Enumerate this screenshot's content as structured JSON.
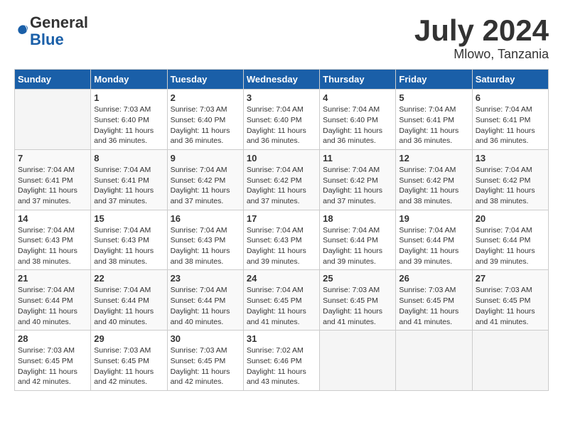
{
  "logo": {
    "general": "General",
    "blue": "Blue"
  },
  "header": {
    "month": "July 2024",
    "location": "Mlowo, Tanzania"
  },
  "weekdays": [
    "Sunday",
    "Monday",
    "Tuesday",
    "Wednesday",
    "Thursday",
    "Friday",
    "Saturday"
  ],
  "weeks": [
    [
      {
        "day": "",
        "sunrise": "",
        "sunset": "",
        "daylight": ""
      },
      {
        "day": "1",
        "sunrise": "7:03 AM",
        "sunset": "6:40 PM",
        "daylight": "11 hours and 36 minutes."
      },
      {
        "day": "2",
        "sunrise": "7:03 AM",
        "sunset": "6:40 PM",
        "daylight": "11 hours and 36 minutes."
      },
      {
        "day": "3",
        "sunrise": "7:04 AM",
        "sunset": "6:40 PM",
        "daylight": "11 hours and 36 minutes."
      },
      {
        "day": "4",
        "sunrise": "7:04 AM",
        "sunset": "6:40 PM",
        "daylight": "11 hours and 36 minutes."
      },
      {
        "day": "5",
        "sunrise": "7:04 AM",
        "sunset": "6:41 PM",
        "daylight": "11 hours and 36 minutes."
      },
      {
        "day": "6",
        "sunrise": "7:04 AM",
        "sunset": "6:41 PM",
        "daylight": "11 hours and 36 minutes."
      }
    ],
    [
      {
        "day": "7",
        "sunrise": "7:04 AM",
        "sunset": "6:41 PM",
        "daylight": "11 hours and 37 minutes."
      },
      {
        "day": "8",
        "sunrise": "7:04 AM",
        "sunset": "6:41 PM",
        "daylight": "11 hours and 37 minutes."
      },
      {
        "day": "9",
        "sunrise": "7:04 AM",
        "sunset": "6:42 PM",
        "daylight": "11 hours and 37 minutes."
      },
      {
        "day": "10",
        "sunrise": "7:04 AM",
        "sunset": "6:42 PM",
        "daylight": "11 hours and 37 minutes."
      },
      {
        "day": "11",
        "sunrise": "7:04 AM",
        "sunset": "6:42 PM",
        "daylight": "11 hours and 37 minutes."
      },
      {
        "day": "12",
        "sunrise": "7:04 AM",
        "sunset": "6:42 PM",
        "daylight": "11 hours and 38 minutes."
      },
      {
        "day": "13",
        "sunrise": "7:04 AM",
        "sunset": "6:42 PM",
        "daylight": "11 hours and 38 minutes."
      }
    ],
    [
      {
        "day": "14",
        "sunrise": "7:04 AM",
        "sunset": "6:43 PM",
        "daylight": "11 hours and 38 minutes."
      },
      {
        "day": "15",
        "sunrise": "7:04 AM",
        "sunset": "6:43 PM",
        "daylight": "11 hours and 38 minutes."
      },
      {
        "day": "16",
        "sunrise": "7:04 AM",
        "sunset": "6:43 PM",
        "daylight": "11 hours and 38 minutes."
      },
      {
        "day": "17",
        "sunrise": "7:04 AM",
        "sunset": "6:43 PM",
        "daylight": "11 hours and 39 minutes."
      },
      {
        "day": "18",
        "sunrise": "7:04 AM",
        "sunset": "6:44 PM",
        "daylight": "11 hours and 39 minutes."
      },
      {
        "day": "19",
        "sunrise": "7:04 AM",
        "sunset": "6:44 PM",
        "daylight": "11 hours and 39 minutes."
      },
      {
        "day": "20",
        "sunrise": "7:04 AM",
        "sunset": "6:44 PM",
        "daylight": "11 hours and 39 minutes."
      }
    ],
    [
      {
        "day": "21",
        "sunrise": "7:04 AM",
        "sunset": "6:44 PM",
        "daylight": "11 hours and 40 minutes."
      },
      {
        "day": "22",
        "sunrise": "7:04 AM",
        "sunset": "6:44 PM",
        "daylight": "11 hours and 40 minutes."
      },
      {
        "day": "23",
        "sunrise": "7:04 AM",
        "sunset": "6:44 PM",
        "daylight": "11 hours and 40 minutes."
      },
      {
        "day": "24",
        "sunrise": "7:04 AM",
        "sunset": "6:45 PM",
        "daylight": "11 hours and 41 minutes."
      },
      {
        "day": "25",
        "sunrise": "7:03 AM",
        "sunset": "6:45 PM",
        "daylight": "11 hours and 41 minutes."
      },
      {
        "day": "26",
        "sunrise": "7:03 AM",
        "sunset": "6:45 PM",
        "daylight": "11 hours and 41 minutes."
      },
      {
        "day": "27",
        "sunrise": "7:03 AM",
        "sunset": "6:45 PM",
        "daylight": "11 hours and 41 minutes."
      }
    ],
    [
      {
        "day": "28",
        "sunrise": "7:03 AM",
        "sunset": "6:45 PM",
        "daylight": "11 hours and 42 minutes."
      },
      {
        "day": "29",
        "sunrise": "7:03 AM",
        "sunset": "6:45 PM",
        "daylight": "11 hours and 42 minutes."
      },
      {
        "day": "30",
        "sunrise": "7:03 AM",
        "sunset": "6:45 PM",
        "daylight": "11 hours and 42 minutes."
      },
      {
        "day": "31",
        "sunrise": "7:02 AM",
        "sunset": "6:46 PM",
        "daylight": "11 hours and 43 minutes."
      },
      {
        "day": "",
        "sunrise": "",
        "sunset": "",
        "daylight": ""
      },
      {
        "day": "",
        "sunrise": "",
        "sunset": "",
        "daylight": ""
      },
      {
        "day": "",
        "sunrise": "",
        "sunset": "",
        "daylight": ""
      }
    ]
  ]
}
